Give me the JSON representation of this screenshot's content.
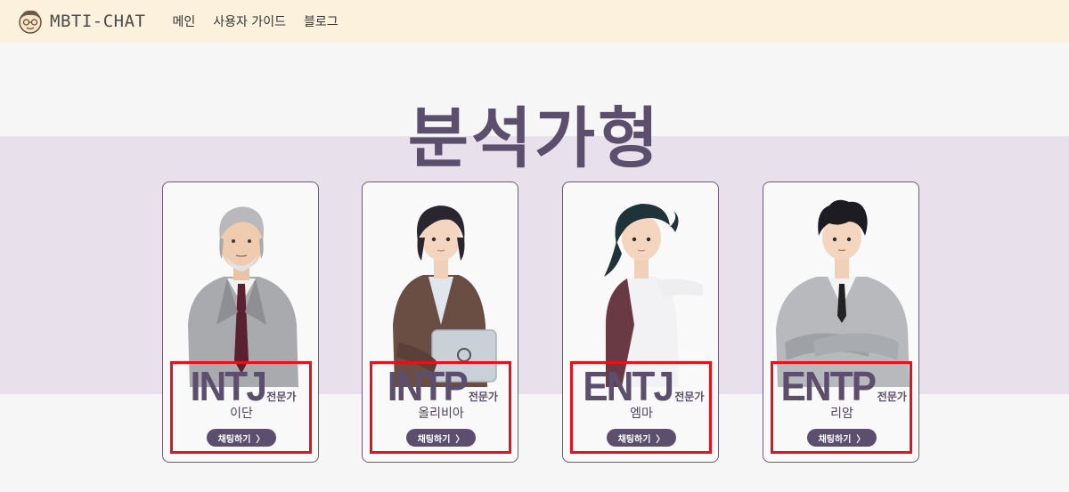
{
  "header": {
    "logo_text": "MBTI-CHAT",
    "nav": [
      {
        "label": "메인"
      },
      {
        "label": "사용자 가이드"
      },
      {
        "label": "블로그"
      }
    ]
  },
  "hero": {
    "title": "분석가형"
  },
  "cards": [
    {
      "type": "INTJ",
      "suffix": "전문가",
      "name": "이단",
      "button": "채팅하기",
      "chevron": "〉"
    },
    {
      "type": "INTP",
      "suffix": "전문가",
      "name": "올리비아",
      "button": "채팅하기",
      "chevron": "〉"
    },
    {
      "type": "ENTJ",
      "suffix": "전문가",
      "name": "엠마",
      "button": "채팅하기",
      "chevron": "〉"
    },
    {
      "type": "ENTP",
      "suffix": "전문가",
      "name": "리암",
      "button": "채팅하기",
      "chevron": "〉"
    }
  ],
  "colors": {
    "header_bg": "#fcf1dc",
    "band_bg": "#e8e1ec",
    "accent": "#5c4f6e",
    "highlight_border": "#e8101a"
  }
}
